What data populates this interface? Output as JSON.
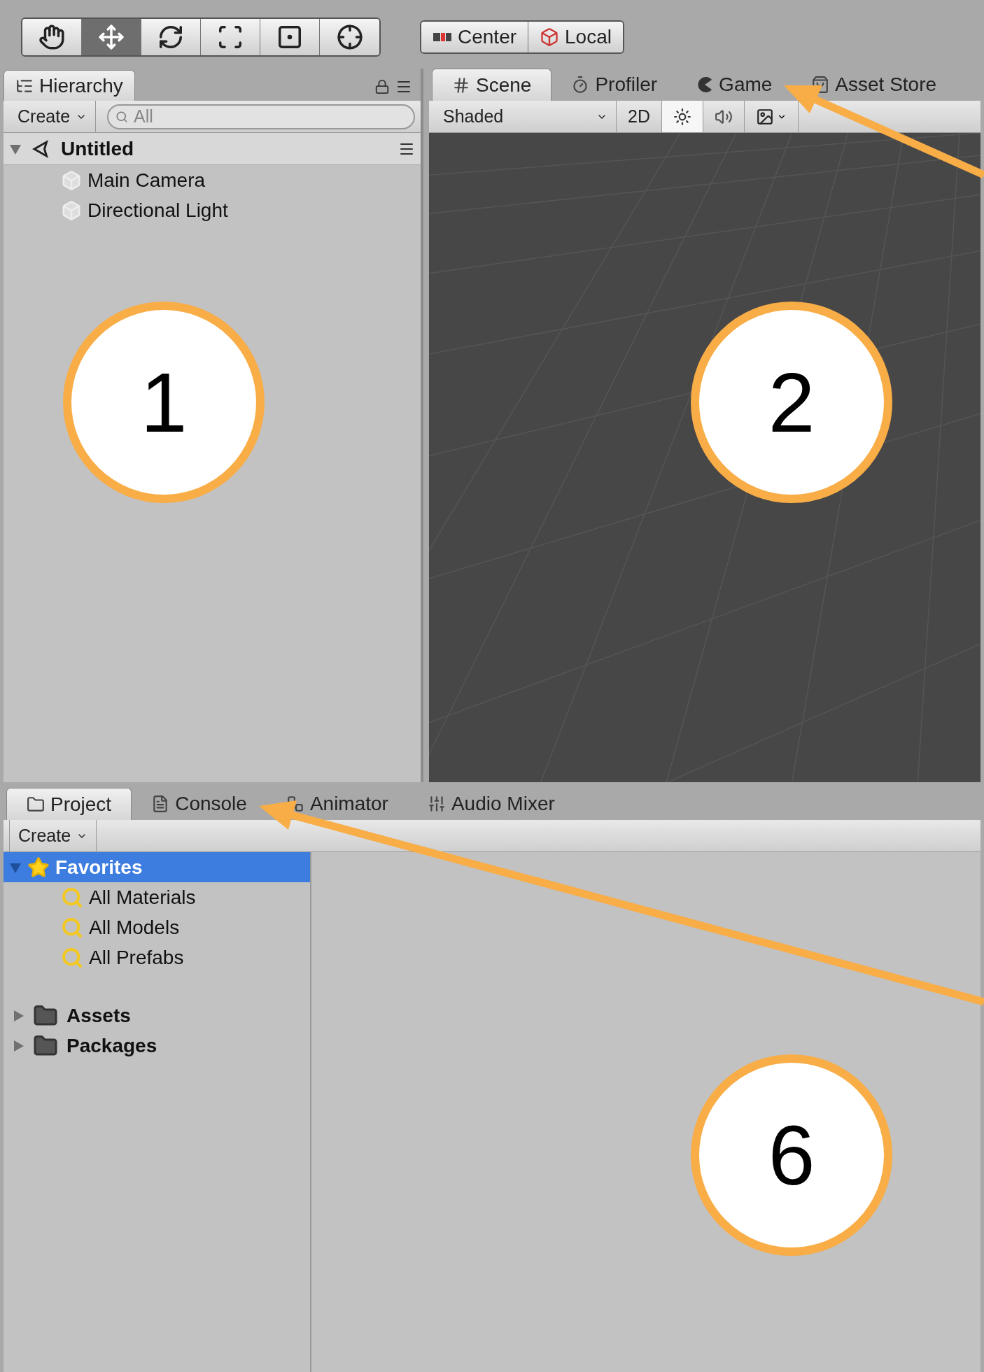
{
  "toolbar": {
    "tools": [
      {
        "selected": false
      },
      {
        "selected": true
      },
      {
        "selected": false
      },
      {
        "selected": false
      },
      {
        "selected": false
      },
      {
        "selected": false
      }
    ],
    "pivot_buttons": [
      "Center",
      "Local"
    ]
  },
  "hierarchy": {
    "tab": "Hierarchy",
    "create": "Create",
    "search": {
      "placeholder": "All"
    },
    "scene": {
      "name": "Untitled",
      "expanded": true,
      "children": [
        {
          "name": "Main Camera"
        },
        {
          "name": "Directional Light"
        }
      ]
    }
  },
  "scene_view": {
    "tabs": [
      {
        "label": "Scene",
        "selected": true
      },
      {
        "label": "Profiler",
        "selected": false
      },
      {
        "label": "Game",
        "selected": false
      },
      {
        "label": "Asset Store",
        "selected": false
      }
    ],
    "shading": "Shaded",
    "controls": [
      {
        "kind": "text",
        "label": "2D",
        "on": false
      },
      {
        "kind": "light",
        "on": true
      },
      {
        "kind": "audio",
        "on": false
      },
      {
        "kind": "effects",
        "on": false
      }
    ]
  },
  "project": {
    "tabs": [
      {
        "label": "Project",
        "selected": true
      },
      {
        "label": "Console",
        "selected": false
      },
      {
        "label": "Animator",
        "selected": false
      },
      {
        "label": "Audio Mixer",
        "selected": false
      }
    ],
    "create": "Create",
    "favorites": {
      "label": "Favorites",
      "expanded": true,
      "selected": true,
      "children": [
        {
          "label": "All Materials"
        },
        {
          "label": "All Models"
        },
        {
          "label": "All Prefabs"
        }
      ]
    },
    "folders": [
      {
        "label": "Assets",
        "expanded": false
      },
      {
        "label": "Packages",
        "expanded": false
      }
    ]
  },
  "annotations": [
    {
      "number": "1"
    },
    {
      "number": "2"
    },
    {
      "number": "6"
    }
  ]
}
